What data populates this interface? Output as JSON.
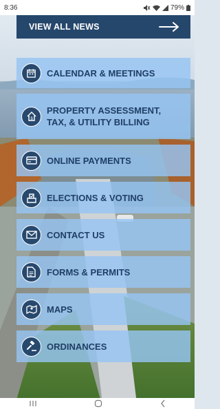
{
  "status_bar": {
    "time": "8:36",
    "battery": "79%"
  },
  "news_button": {
    "label": "VIEW ALL NEWS",
    "icon": "arrow-right-icon"
  },
  "menu": [
    {
      "id": "calendar",
      "label_lines": [
        "CALENDAR & MEETINGS"
      ],
      "icon": "calendar-icon"
    },
    {
      "id": "property",
      "label_lines": [
        "PROPERTY ASSESSMENT,",
        "TAX, & UTILITY BILLING"
      ],
      "icon": "house-dollar-icon"
    },
    {
      "id": "payments",
      "label_lines": [
        "ONLINE PAYMENTS"
      ],
      "icon": "credit-card-icon"
    },
    {
      "id": "elections",
      "label_lines": [
        "ELECTIONS & VOTING"
      ],
      "icon": "ballot-box-icon"
    },
    {
      "id": "contact",
      "label_lines": [
        "CONTACT US"
      ],
      "icon": "envelope-icon"
    },
    {
      "id": "forms",
      "label_lines": [
        "FORMS & PERMITS"
      ],
      "icon": "document-icon"
    },
    {
      "id": "maps",
      "label_lines": [
        "MAPS"
      ],
      "icon": "map-icon"
    },
    {
      "id": "ordinances",
      "label_lines": [
        "ORDINANCES"
      ],
      "icon": "gavel-icon"
    }
  ],
  "nav_bar": {
    "recents": "recents-icon",
    "home": "home-icon",
    "back": "back-icon"
  }
}
